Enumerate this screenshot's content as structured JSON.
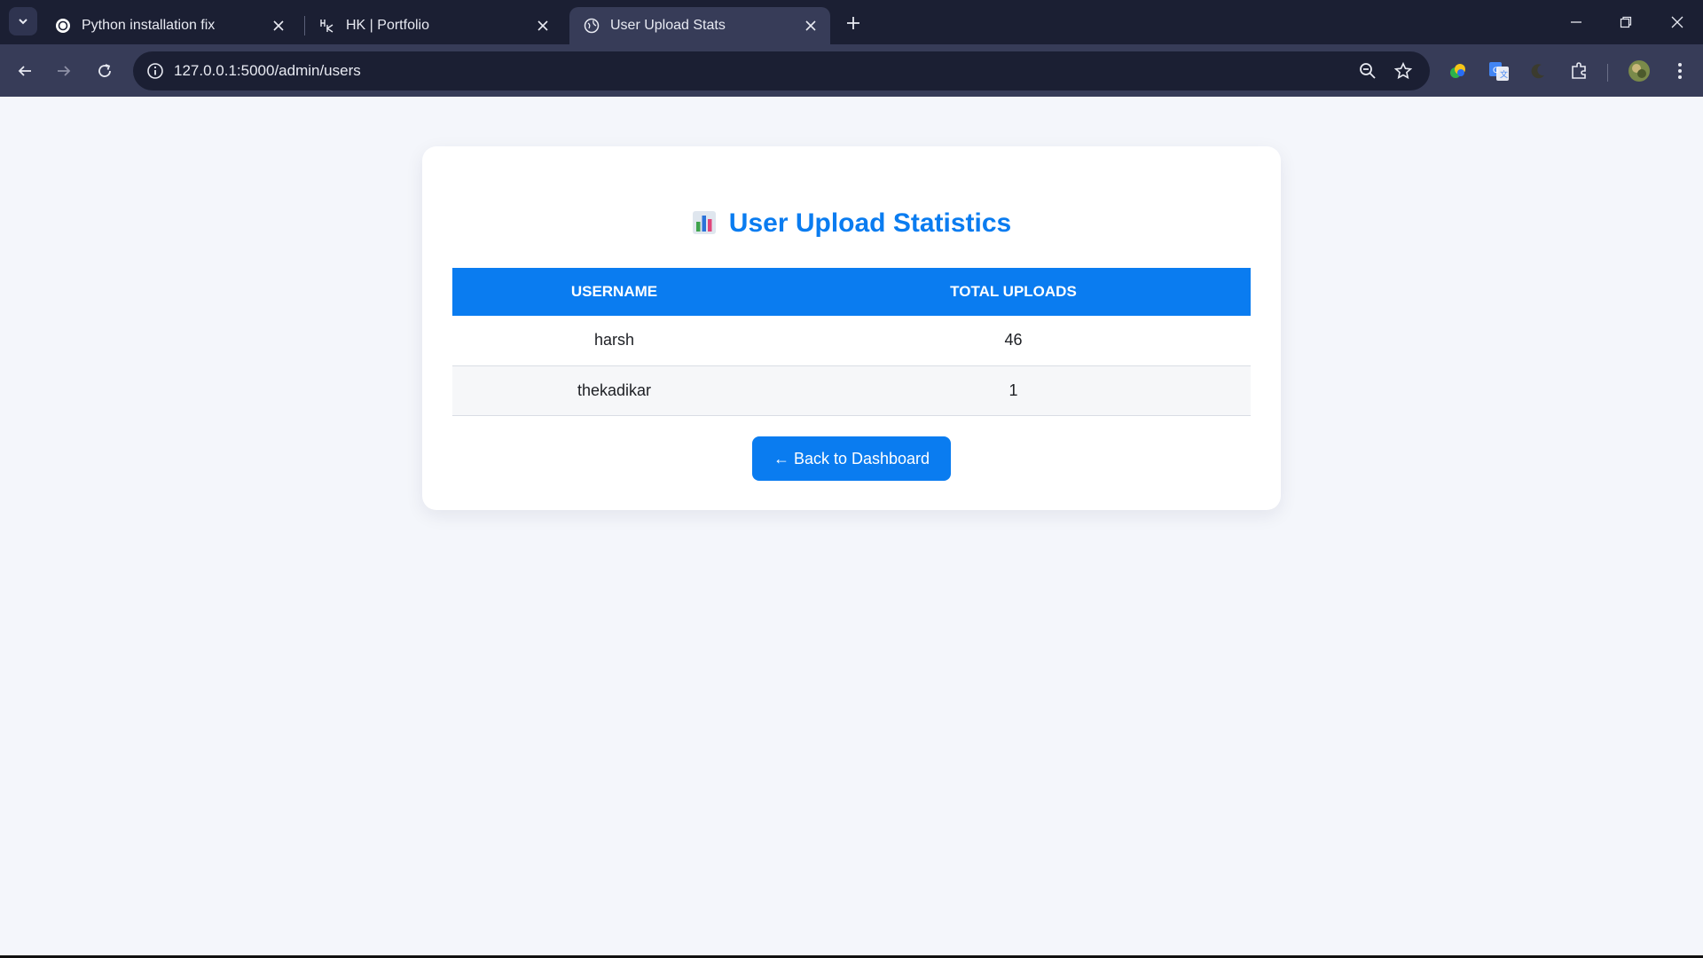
{
  "browser": {
    "tabs": [
      {
        "title": "Python installation fix",
        "active": false
      },
      {
        "title": "HK | Portfolio",
        "active": false
      },
      {
        "title": "User Upload Stats",
        "active": true
      }
    ],
    "url": "127.0.0.1:5000/admin/users",
    "colors": {
      "tabstrip": "#1b1f33",
      "toolbar": "#373c58"
    }
  },
  "page": {
    "title": "User Upload Statistics",
    "title_icon": "bar-chart-icon",
    "table": {
      "headers": [
        "Username",
        "Total Uploads"
      ],
      "rows": [
        {
          "username": "harsh",
          "uploads": "46"
        },
        {
          "username": "thekadikar",
          "uploads": "1"
        }
      ]
    },
    "back_button": "← Back to Dashboard",
    "colors": {
      "accent": "#0a7cf0",
      "background": "#f4f6fb"
    }
  }
}
